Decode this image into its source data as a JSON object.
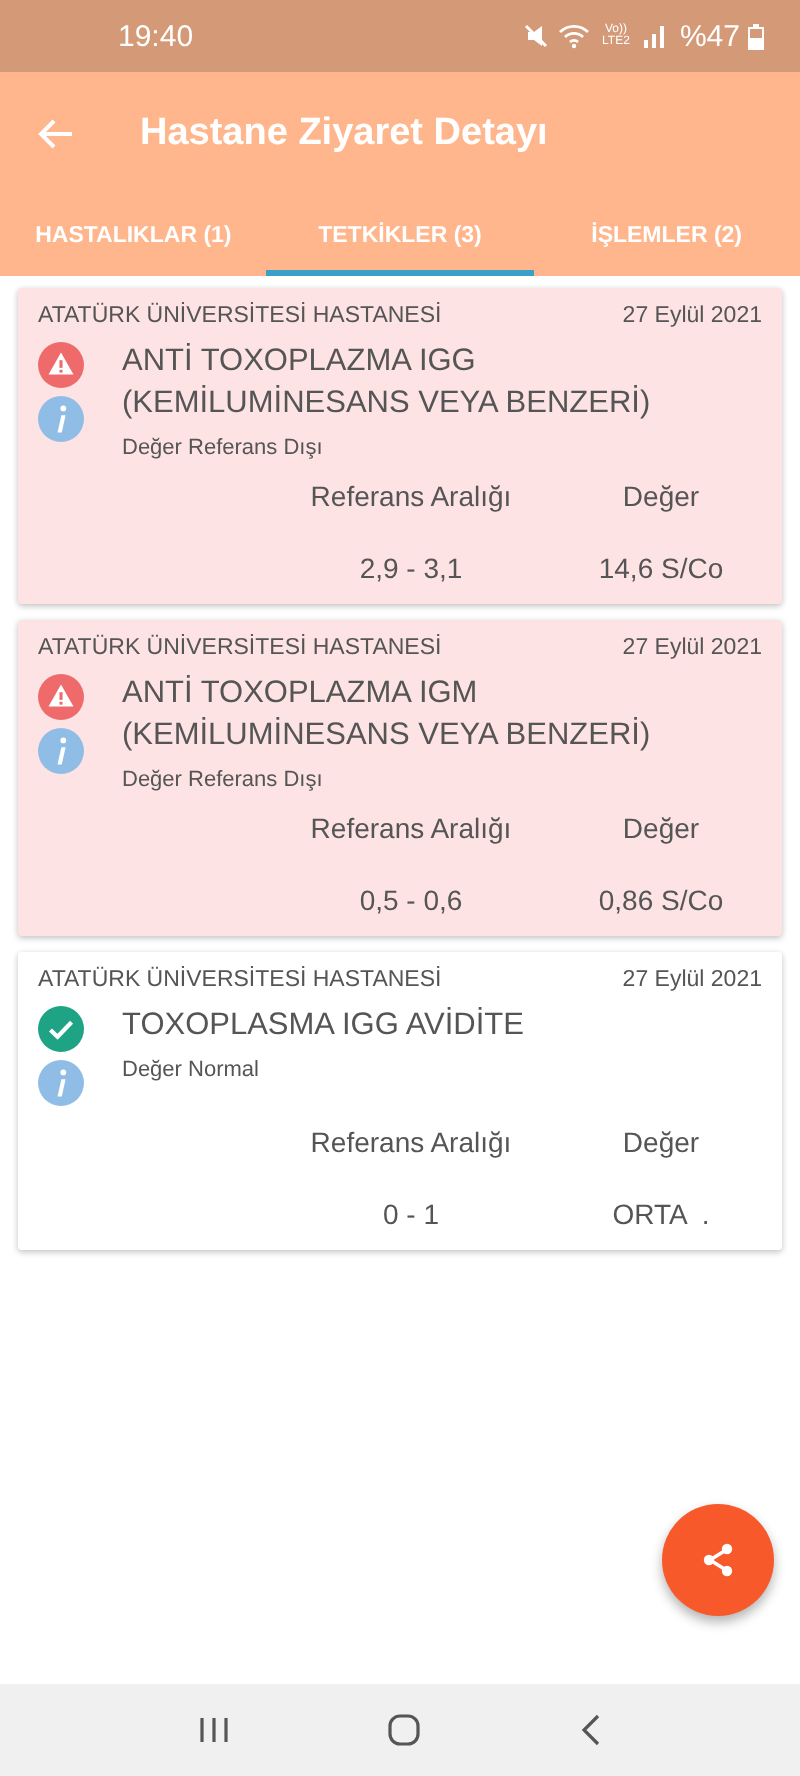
{
  "status_bar": {
    "time": "19:40",
    "network": "Vo)) LTE2",
    "battery": "%47"
  },
  "app_bar": {
    "title": "Hastane Ziyaret Detayı"
  },
  "tabs": [
    {
      "label": "HASTALIKLAR (1)",
      "selected": false
    },
    {
      "label": "TETKİKLER (3)",
      "selected": true
    },
    {
      "label": "İŞLEMLER (2)",
      "selected": false
    }
  ],
  "results": [
    {
      "kind": "abnormal",
      "hospital": "ATATÜRK ÜNİVERSİTESİ HASTANESİ",
      "date": "27 Eylül 2021",
      "test": "ANTİ TOXOPLAZMA IGG (KEMİLUMİNESANS VEYA BENZERİ)",
      "status": "Değer Referans Dışı",
      "range_label": "Referans Aralığı",
      "value_label": "Değer",
      "range": "2,9 - 3,1",
      "value": "14,6 S/Co"
    },
    {
      "kind": "abnormal",
      "hospital": "ATATÜRK ÜNİVERSİTESİ HASTANESİ",
      "date": "27 Eylül 2021",
      "test": "ANTİ TOXOPLAZMA IGM (KEMİLUMİNESANS VEYA BENZERİ)",
      "status": "Değer Referans Dışı",
      "range_label": "Referans Aralığı",
      "value_label": "Değer",
      "range": "0,5 - 0,6",
      "value": "0,86 S/Co"
    },
    {
      "kind": "normal",
      "hospital": "ATATÜRK ÜNİVERSİTESİ HASTANESİ",
      "date": "27 Eylül 2021",
      "test": "TOXOPLASMA IGG AVİDİTE",
      "status": "Değer Normal",
      "range_label": "Referans Aralığı",
      "value_label": "Değer",
      "range": "0 - 1",
      "value": "ORTA  ."
    }
  ]
}
